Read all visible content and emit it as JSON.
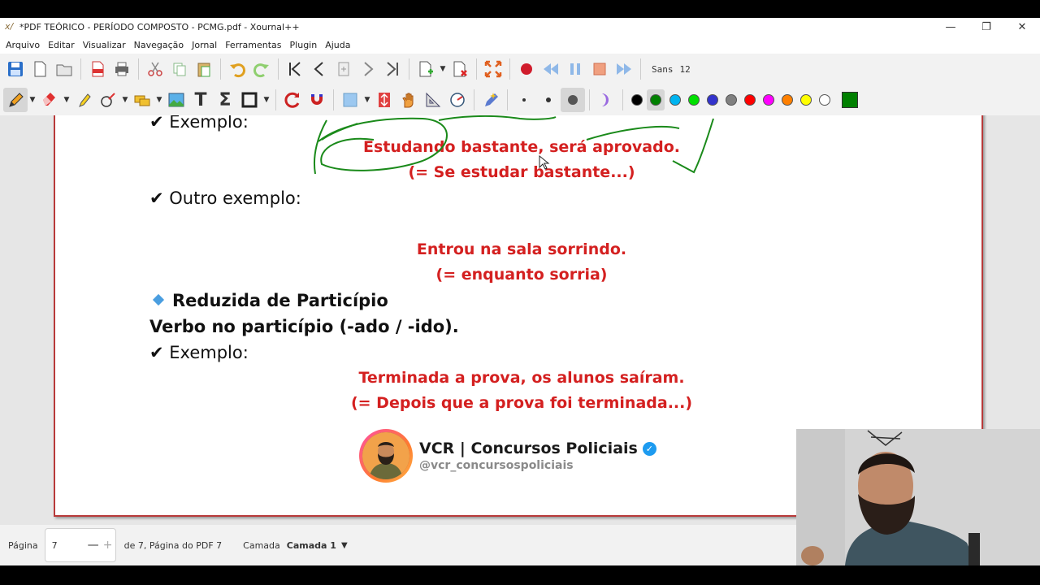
{
  "window": {
    "title": "*PDF TEÓRICO - PERÍODO COMPOSTO - PCMG.pdf - Xournal++",
    "app_icon": "x/",
    "minimize": "—",
    "restore": "❐",
    "close": "✕"
  },
  "menu": [
    "Arquivo",
    "Editar",
    "Visualizar",
    "Navegação",
    "Jornal",
    "Ferramentas",
    "Plugin",
    "Ajuda"
  ],
  "toolbar": {
    "font_name": "Sans",
    "font_size": "12",
    "colors": [
      "#000000",
      "#008000",
      "#00b4f0",
      "#00e000",
      "#3333cc",
      "#808080",
      "#ff0000",
      "#ff00ff",
      "#ff8000",
      "#ffff00",
      "#ffffff"
    ],
    "selected_color": "#008000",
    "color_square": "#008000"
  },
  "document": {
    "line1": "✔ Exemplo:",
    "red1a": "Estudando bastante, será aprovado.",
    "red1b": "(= Se estudar bastante...)",
    "line2": "✔ Outro exemplo:",
    "red2a": "Entrou na sala sorrindo.",
    "red2b": "(= enquanto sorria)",
    "heading": "Reduzida de Particípio",
    "line3": "Verbo no particípio (-ado / -ido).",
    "line4": "✔ Exemplo:",
    "red3a": "Terminada a prova, os alunos saíram.",
    "red3b": "(= Depois que a prova foi terminada...)",
    "brand_name": "VCR | Concursos Policiais",
    "brand_handle": "@vcr_concursospoliciais",
    "verified_mark": "✓"
  },
  "status": {
    "page_label": "Página",
    "page_value": "7",
    "minus": "—",
    "plus": "+",
    "page_of": "de 7, Página do PDF 7",
    "layer_label": "Camada",
    "layer_value": "Camada 1"
  }
}
